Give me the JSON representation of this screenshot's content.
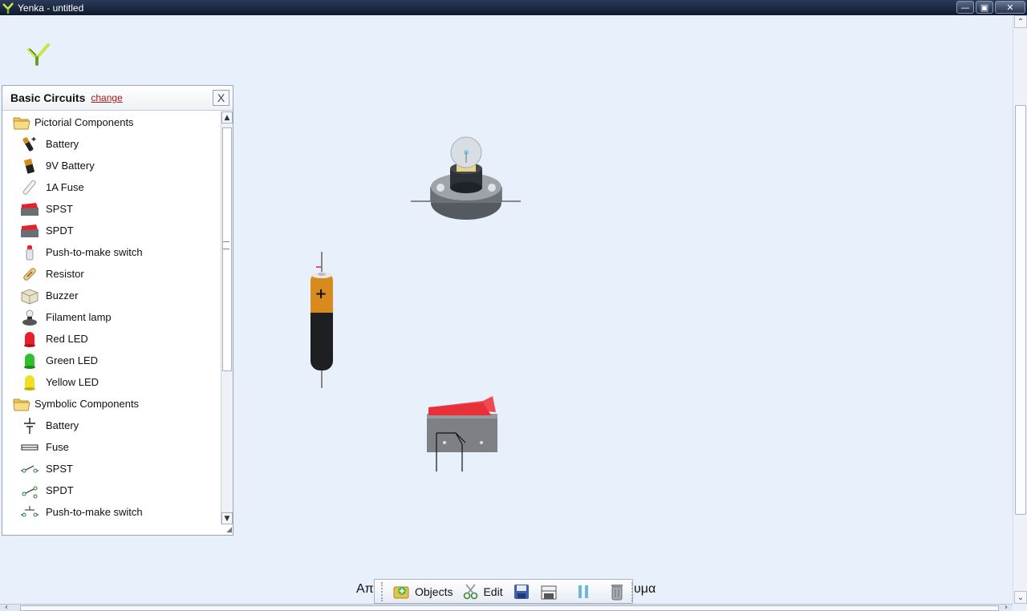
{
  "window": {
    "title": "Yenka - untitled",
    "min_glyph": "—",
    "max_glyph": "▣",
    "close_glyph": "✕"
  },
  "panel": {
    "title": "Basic Circuits",
    "change_link": "change",
    "close_label": "X",
    "groups": [
      {
        "label": "Pictorial Components",
        "items": [
          {
            "label": "Battery",
            "icon": "battery-icon"
          },
          {
            "label": "9V Battery",
            "icon": "9v-battery-icon"
          },
          {
            "label": "1A Fuse",
            "icon": "fuse-icon"
          },
          {
            "label": "SPST",
            "icon": "spst-switch-icon"
          },
          {
            "label": "SPDT",
            "icon": "spdt-switch-icon"
          },
          {
            "label": "Push-to-make switch",
            "icon": "push-switch-icon"
          },
          {
            "label": "Resistor",
            "icon": "resistor-icon"
          },
          {
            "label": "Buzzer",
            "icon": "buzzer-icon"
          },
          {
            "label": "Filament lamp",
            "icon": "filament-lamp-icon"
          },
          {
            "label": "Red LED",
            "icon": "red-led-icon"
          },
          {
            "label": "Green LED",
            "icon": "green-led-icon"
          },
          {
            "label": "Yellow LED",
            "icon": "yellow-led-icon"
          }
        ]
      },
      {
        "label": "Symbolic Components",
        "items": [
          {
            "label": "Battery",
            "icon": "battery-symbol-icon"
          },
          {
            "label": "Fuse",
            "icon": "fuse-symbol-icon"
          },
          {
            "label": "SPST",
            "icon": "spst-symbol-icon"
          },
          {
            "label": "SPDT",
            "icon": "spdt-symbol-icon"
          },
          {
            "label": "Push-to-make switch",
            "icon": "push-switch-symbol-icon"
          }
        ]
      }
    ]
  },
  "canvas": {
    "components": [
      "filament-lamp",
      "battery",
      "spst-switch"
    ],
    "battery_sign": "+"
  },
  "toolbar": {
    "objects_label": "Objects",
    "edit_label": "Edit",
    "status_left": "Απ",
    "status_right": "υμα"
  },
  "colors": {
    "background": "#e8f0fb",
    "accent_red": "#e8202a",
    "battery_orange": "#d98a1c"
  }
}
